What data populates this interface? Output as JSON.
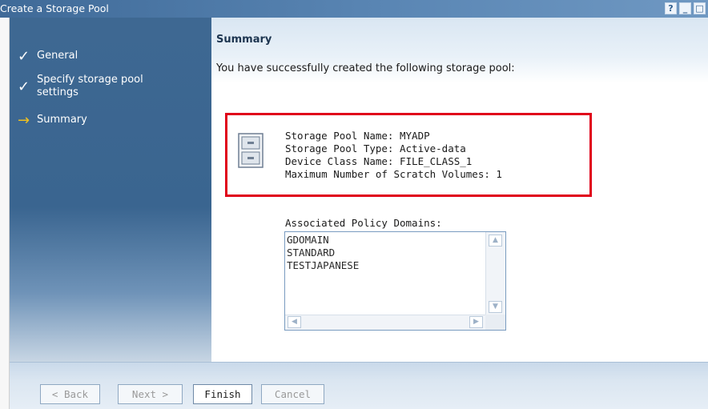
{
  "window": {
    "title": "Create a Storage Pool",
    "help_label": "?",
    "minimize_label": "_",
    "restore_label": "□"
  },
  "sidebar": {
    "steps": [
      {
        "label": "General",
        "state": "done",
        "icon": "check-icon"
      },
      {
        "label": "Specify storage pool settings",
        "state": "done",
        "icon": "check-icon"
      },
      {
        "label": "Summary",
        "state": "current",
        "icon": "arrow-right-icon"
      }
    ]
  },
  "summary": {
    "title": "Summary",
    "description": "You have successfully created the following storage pool:",
    "fields": [
      "Storage Pool Name: MYADP",
      "Storage Pool Type: Active-data",
      "Device Class Name: FILE_CLASS_1",
      "Maximum Number of Scratch Volumes: 1"
    ],
    "icon": "file-cabinet-icon",
    "highlight_color": "#e0001a"
  },
  "policy_domains": {
    "label": "Associated Policy Domains:",
    "items": [
      "GDOMAIN",
      "STANDARD",
      "TESTJAPANESE"
    ]
  },
  "buttons": {
    "back": "< Back",
    "next": "Next >",
    "finish": "Finish",
    "cancel": "Cancel"
  },
  "colors": {
    "titlebar": "#3f6a98",
    "sidebar": "#3e6892",
    "accent_arrow": "#f0c020"
  }
}
